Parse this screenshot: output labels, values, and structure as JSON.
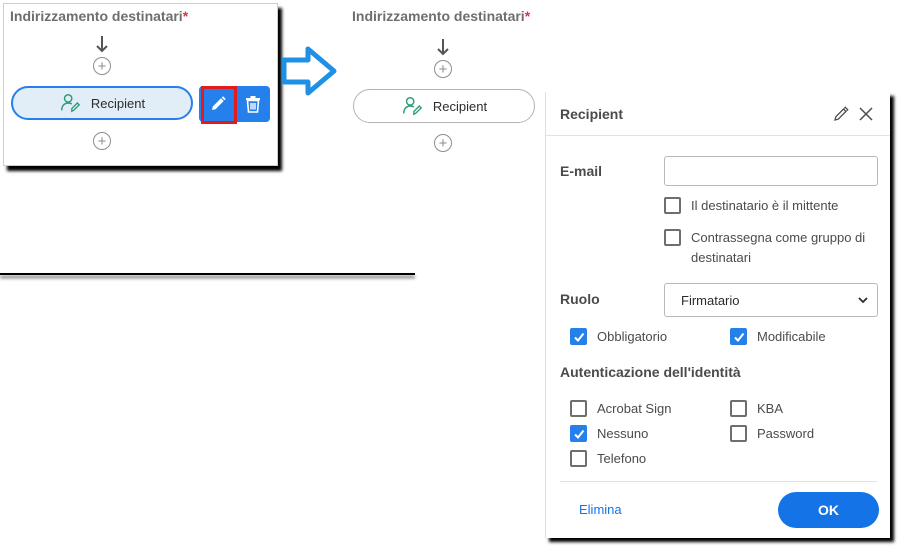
{
  "left": {
    "section_title": "Indirizzamento destinatari",
    "required_mark": "*",
    "recipient_label": "Recipient",
    "add_icon": "plus-circle-icon",
    "edit_icon": "pencil-icon",
    "delete_icon": "trash-icon"
  },
  "right": {
    "section_title": "Indirizzamento destinatari",
    "required_mark": "*",
    "recipient_label": "Recipient"
  },
  "panel": {
    "title": "Recipient",
    "email_label": "E-mail",
    "email_value": "",
    "checkbox_sender": {
      "label": "Il destinatario è il mittente",
      "checked": false
    },
    "checkbox_group": {
      "label_line1": "Contrassegna come gruppo di",
      "label_line2": "destinatari",
      "checked": false
    },
    "role_label": "Ruolo",
    "role_value": "Firmatario",
    "mandatory": {
      "label": "Obbligatorio",
      "checked": true
    },
    "editable": {
      "label": "Modificabile",
      "checked": true
    },
    "auth_title": "Autenticazione dell'identità",
    "auth_options": {
      "acrobat_sign": {
        "label": "Acrobat Sign",
        "checked": false
      },
      "kba": {
        "label": "KBA",
        "checked": false
      },
      "none": {
        "label": "Nessuno",
        "checked": true
      },
      "password": {
        "label": "Password",
        "checked": false
      },
      "phone": {
        "label": "Telefono",
        "checked": false
      }
    },
    "delete_label": "Elimina",
    "ok_label": "OK"
  },
  "colors": {
    "accent": "#2680eb",
    "highlight": "#e21c1c",
    "required": "#d7373f",
    "icon_green": "#2d9d78",
    "arrow": "#2196f3"
  }
}
